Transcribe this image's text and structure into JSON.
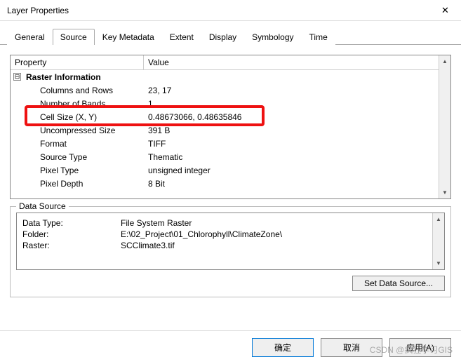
{
  "window": {
    "title": "Layer Properties",
    "close_icon": "✕"
  },
  "tabs": [
    {
      "label": "General"
    },
    {
      "label": "Source"
    },
    {
      "label": "Key Metadata"
    },
    {
      "label": "Extent"
    },
    {
      "label": "Display"
    },
    {
      "label": "Symbology"
    },
    {
      "label": "Time"
    }
  ],
  "active_tab": 1,
  "grid": {
    "headers": {
      "property": "Property",
      "value": "Value"
    },
    "group_label": "Raster Information",
    "toggle_glyph": "⊟",
    "rows": [
      {
        "prop": "Columns and Rows",
        "val": "23, 17"
      },
      {
        "prop": "Number of Bands",
        "val": "1"
      },
      {
        "prop": "Cell Size (X, Y)",
        "val": "0.48673066, 0.48635846"
      },
      {
        "prop": "Uncompressed Size",
        "val": "391 B"
      },
      {
        "prop": "Format",
        "val": "TIFF"
      },
      {
        "prop": "Source Type",
        "val": "Thematic"
      },
      {
        "prop": "Pixel Type",
        "val": "unsigned integer"
      },
      {
        "prop": "Pixel Depth",
        "val": "8 Bit"
      }
    ]
  },
  "data_source": {
    "legend": "Data Source",
    "rows": [
      {
        "label": "Data Type:",
        "value": "File System Raster"
      },
      {
        "label": "Folder:",
        "value": "E:\\02_Project\\01_Chlorophyll\\ClimateZone\\"
      },
      {
        "label": "Raster:",
        "value": "SCClimate3.tif"
      }
    ],
    "set_button": "Set Data Source..."
  },
  "footer": {
    "ok": "确定",
    "cancel": "取消",
    "apply": "应用(A)"
  },
  "scroll": {
    "up": "▲",
    "down": "▼"
  },
  "watermark": "CSDN @疯狂学习GIS"
}
